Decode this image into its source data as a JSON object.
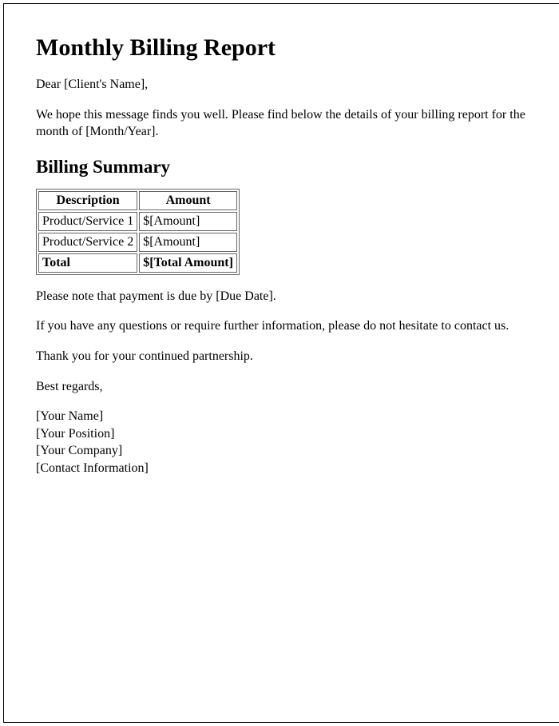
{
  "title": "Monthly Billing Report",
  "greeting": "Dear [Client's Name],",
  "intro": "We hope this message finds you well. Please find below the details of your billing report for the month of [Month/Year].",
  "summary_heading": "Billing Summary",
  "table": {
    "headers": {
      "description": "Description",
      "amount": "Amount"
    },
    "rows": [
      {
        "description": "Product/Service 1",
        "amount": "$[Amount]"
      },
      {
        "description": "Product/Service 2",
        "amount": "$[Amount]"
      }
    ],
    "total": {
      "label": "Total",
      "amount": "$[Total Amount]"
    }
  },
  "due_note": "Please note that payment is due by [Due Date].",
  "contact_note": "If you have any questions or require further information, please do not hesitate to contact us.",
  "thanks": "Thank you for your continued partnership.",
  "signoff": "Best regards,",
  "signature": {
    "name": "[Your Name]",
    "position": "[Your Position]",
    "company": "[Your Company]",
    "contact": "[Contact Information]"
  }
}
